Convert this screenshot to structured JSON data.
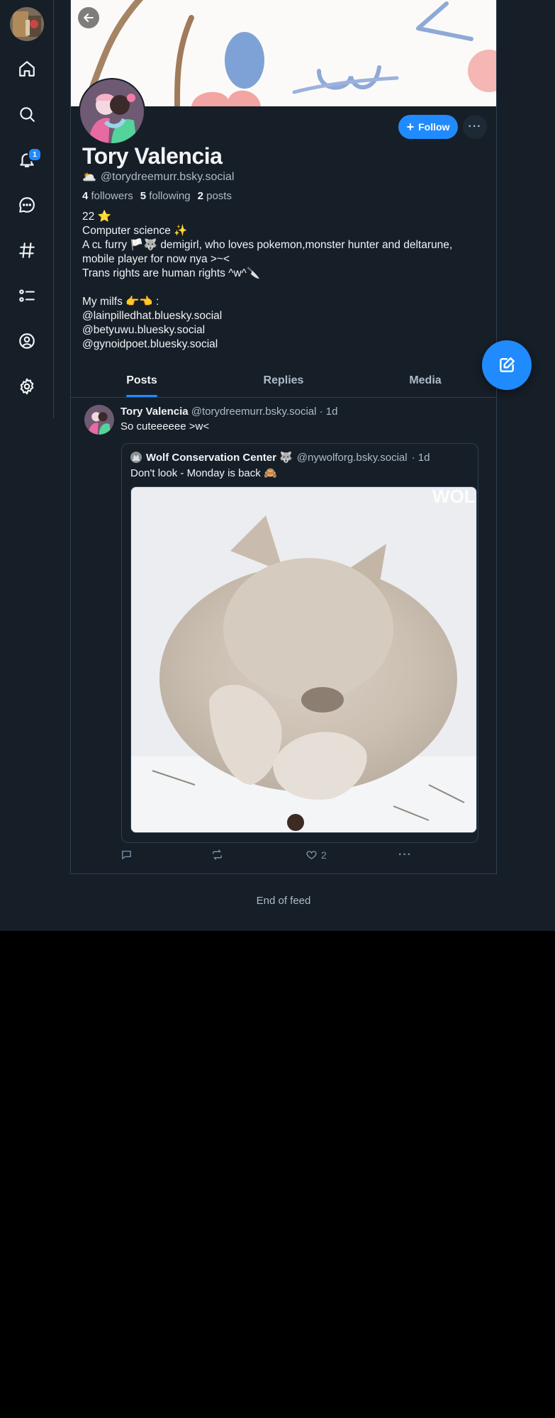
{
  "nav": {
    "notification_count": "1",
    "items": [
      "home",
      "search",
      "notifications",
      "chat",
      "feeds",
      "lists",
      "profile",
      "settings"
    ]
  },
  "profile": {
    "display_name": "Tory Valencia",
    "handle_emoji": "🌥️",
    "handle": "@torydreemurr.bsky.social",
    "followers_count": "4",
    "followers_label": "followers",
    "following_count": "5",
    "following_label": "following",
    "posts_count": "2",
    "posts_label": "posts",
    "follow_label": "Follow",
    "bio_lines": [
      "22 ⭐",
      "Computer science ✨",
      "A ᴄʟ furry 🏳️🐺 demigirl, who loves pokemon,monster hunter and deltarune,",
      "mobile player for now nya >~<",
      "Trans rights are human rights ^w^🔪",
      "",
      "My milfs 👉👈 :",
      "@lainpilledhat.bluesky.social",
      "@betyuwu.bluesky.social",
      "@gynoidpoet.bluesky.social"
    ]
  },
  "tabs": [
    {
      "label": "Posts",
      "active": true
    },
    {
      "label": "Replies",
      "active": false
    },
    {
      "label": "Media",
      "active": false
    }
  ],
  "post": {
    "author_name": "Tory Valencia",
    "author_handle": "@torydreemurr.bsky.social",
    "time": "· 1d",
    "text": "So cuteeeeee >w<",
    "quote": {
      "author_name": "Wolf Conservation Center 🐺",
      "author_handle": "@nywolforg.bsky.social",
      "time": "· 1d",
      "text": "Don't look - Monday is back 🙈",
      "image_watermark": "WOLF"
    },
    "like_count": "2"
  },
  "end_of_feed": "End of feed",
  "colors": {
    "background": "#161e27",
    "accent": "#208bfe",
    "border": "#2e4052",
    "muted_text": "#aebbc9"
  }
}
